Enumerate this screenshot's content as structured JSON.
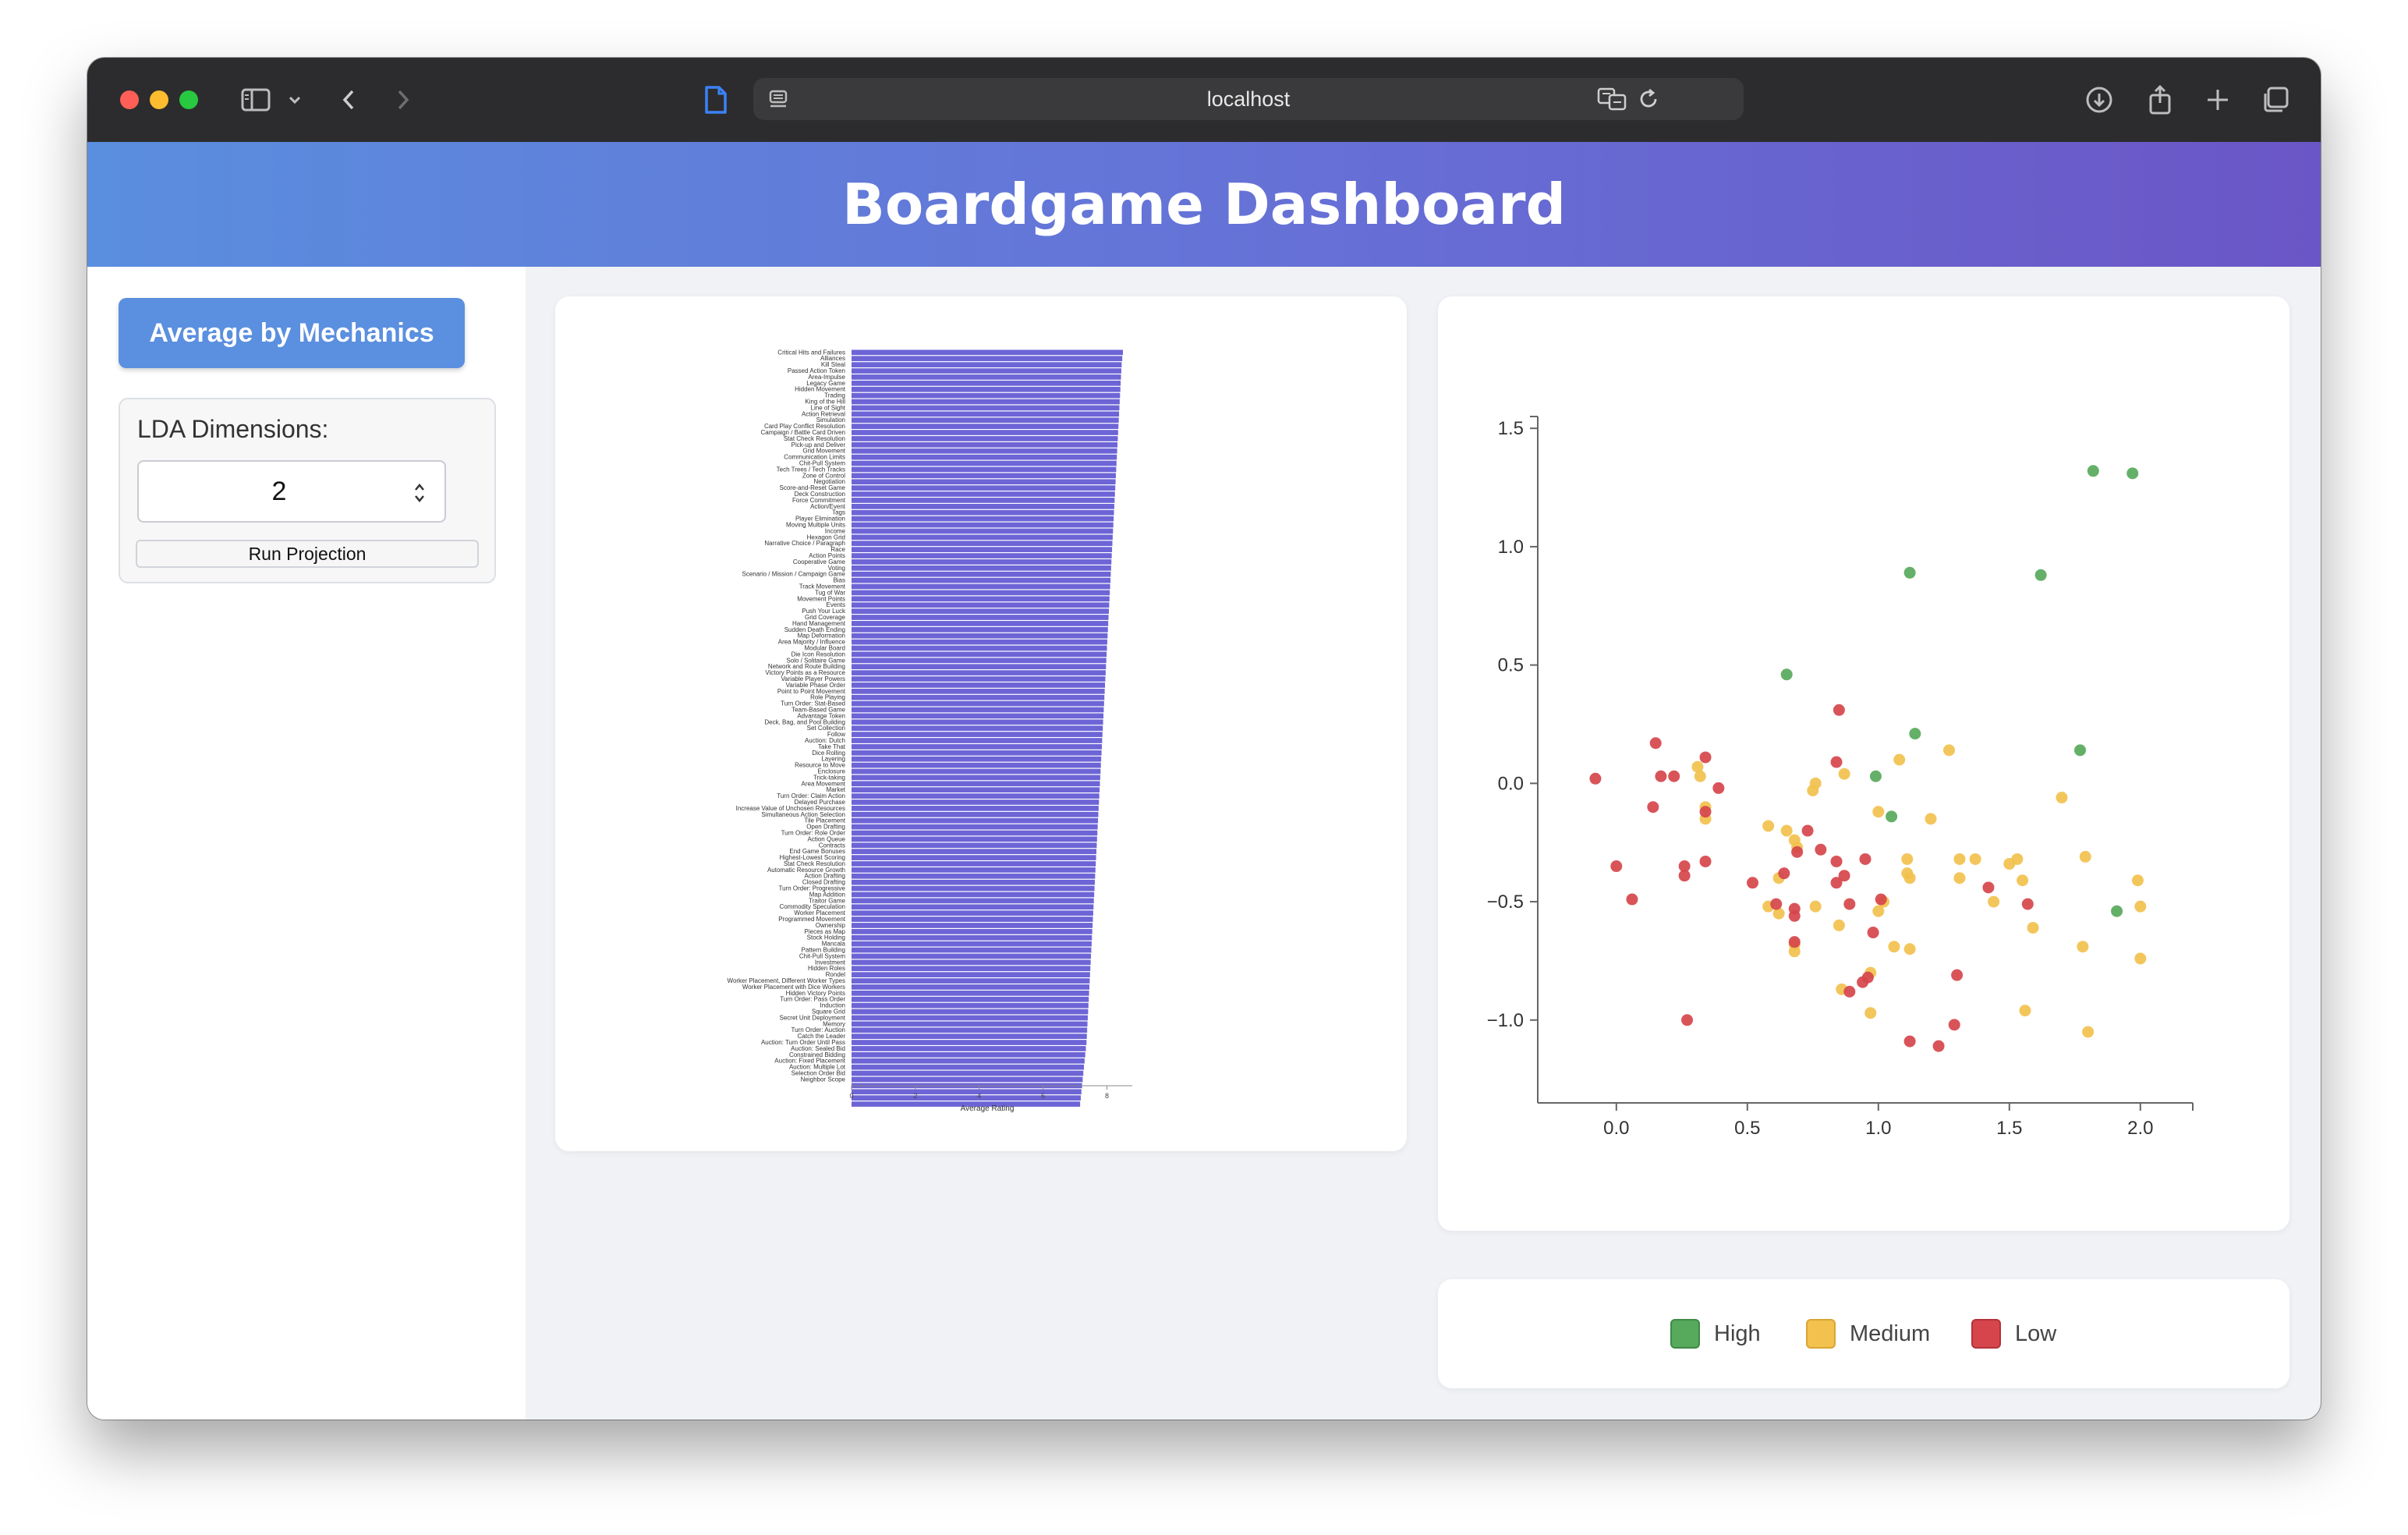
{
  "browser": {
    "url": "localhost"
  },
  "header": {
    "title": "Boardgame Dashboard"
  },
  "sidebar": {
    "average_button_label": "Average by Mechanics",
    "lda_label": "LDA Dimensions:",
    "lda_value": "2",
    "run_button_label": "Run Projection"
  },
  "colors": {
    "high": "#57a95b",
    "medium": "#f2c14e",
    "low": "#d6454b",
    "bar": "#6d64d6",
    "header_start": "#5a8ede",
    "header_end": "#6b56c6"
  },
  "legend": {
    "high": "High",
    "medium": "Medium",
    "low": "Low"
  },
  "chart_data": [
    {
      "type": "bar",
      "orientation": "horizontal",
      "xlabel": "Average Rating",
      "xlim": [
        0,
        8.5
      ],
      "xticks": [
        0,
        2,
        4,
        6,
        8
      ],
      "categories": [
        "Critical Hits and Failures",
        "Alliances",
        "Kill Steal",
        "Passed Action Token",
        "Area-Impulse",
        "Legacy Game",
        "Hidden Movement",
        "Trading",
        "King of the Hill",
        "Line of Sight",
        "Action Retrieval",
        "Simulation",
        "Card Play Conflict Resolution",
        "Campaign / Battle Card Driven",
        "Stat Check Resolution",
        "Pick-up and Deliver",
        "Grid Movement",
        "Communication Limits",
        "Chit-Pull System",
        "Tech Trees / Tech Tracks",
        "Zone of Control",
        "Negotiation",
        "Score-and-Reset Game",
        "Deck Construction",
        "Force Commitment",
        "Action/Event",
        "Tags",
        "Player Elimination",
        "Moving Multiple Units",
        "Income",
        "Hexagon Grid",
        "Narrative Choice / Paragraph",
        "Race",
        "Action Points",
        "Cooperative Game",
        "Voting",
        "Scenario / Mission / Campaign Game",
        "Bias",
        "Track Movement",
        "Tug of War",
        "Movement Points",
        "Events",
        "Push Your Luck",
        "Grid Coverage",
        "Hand Management",
        "Sudden Death Ending",
        "Map Deformation",
        "Area Majority / Influence",
        "Modular Board",
        "Die Icon Resolution",
        "Solo / Solitaire Game",
        "Network and Route Building",
        "Victory Points as a Resource",
        "Variable Player Powers",
        "Variable Phase Order",
        "Point to Point Movement",
        "Role Playing",
        "Turn Order: Stat-Based",
        "Team-Based Game",
        "Advantage Token",
        "Deck, Bag, and Pool Building",
        "Set Collection",
        "Follow",
        "Auction: Dutch",
        "Take That",
        "Dice Rolling",
        "Layering",
        "Resource to Move",
        "Enclosure",
        "Trick-taking",
        "Area Movement",
        "Market",
        "Turn Order: Claim Action",
        "Delayed Purchase",
        "Increase Value of Unchosen Resources",
        "Simultaneous Action Selection",
        "Tile Placement",
        "Open Drafting",
        "Turn Order: Role Order",
        "Action Queue",
        "Contracts",
        "End Game Bonuses",
        "Highest-Lowest Scoring",
        "Stat Check Resolution",
        "Automatic Resource Growth",
        "Action Drafting",
        "Closed Drafting",
        "Turn Order: Progressive",
        "Map Addition",
        "Traitor Game",
        "Commodity Speculation",
        "Worker Placement",
        "Programmed Movement",
        "Ownership",
        "Pieces as Map",
        "Stock Holding",
        "Mancala",
        "Pattern Building",
        "Chit-Pull System",
        "Investment",
        "Hidden Roles",
        "Rondel",
        "Worker Placement, Different Worker Types",
        "Worker Placement with Dice Workers",
        "Hidden Victory Points",
        "Turn Order: Pass Order",
        "Induction",
        "Square Grid",
        "Secret Unit Deployment",
        "Memory",
        "Turn Order: Auction",
        "Catch the Leader",
        "Auction: Turn Order Until Pass",
        "Auction: Sealed Bid",
        "Constrained Bidding",
        "Auction: Fixed Placement",
        "Auction: Multiple Lot",
        "Selection Order Bid",
        "Neighbor Scope"
      ],
      "values": [
        8.5,
        8.48,
        8.46,
        8.45,
        8.44,
        8.43,
        8.42,
        8.41,
        8.4,
        8.39,
        8.38,
        8.37,
        8.36,
        8.35,
        8.34,
        8.33,
        8.32,
        8.31,
        8.3,
        8.29,
        8.28,
        8.27,
        8.26,
        8.25,
        8.24,
        8.23,
        8.22,
        8.21,
        8.2,
        8.19,
        8.18,
        8.17,
        8.16,
        8.15,
        8.14,
        8.13,
        8.12,
        8.11,
        8.1,
        8.09,
        8.08,
        8.07,
        8.06,
        8.05,
        8.04,
        8.03,
        8.02,
        8.01,
        8.0,
        7.99,
        7.98,
        7.97,
        7.96,
        7.95,
        7.94,
        7.93,
        7.92,
        7.91,
        7.9,
        7.89,
        7.88,
        7.87,
        7.86,
        7.85,
        7.84,
        7.83,
        7.82,
        7.81,
        7.8,
        7.79,
        7.78,
        7.77,
        7.76,
        7.75,
        7.74,
        7.73,
        7.72,
        7.71,
        7.7,
        7.69,
        7.68,
        7.67,
        7.66,
        7.65,
        7.64,
        7.63,
        7.62,
        7.61,
        7.6,
        7.59,
        7.58,
        7.57,
        7.56,
        7.55,
        7.54,
        7.53,
        7.52,
        7.51,
        7.5,
        7.49,
        7.48,
        7.47,
        7.46,
        7.45,
        7.44,
        7.43,
        7.42,
        7.41,
        7.4,
        7.39,
        7.38,
        7.37,
        7.36,
        7.34,
        7.32,
        7.3,
        7.28,
        7.26,
        7.24,
        7.22,
        7.2,
        7.18,
        7.16
      ]
    },
    {
      "type": "scatter",
      "xlim": [
        -0.3,
        2.2
      ],
      "ylim": [
        -1.35,
        1.55
      ],
      "xticks": [
        0.0,
        0.5,
        1.0,
        1.5,
        2.0
      ],
      "yticks": [
        1.5,
        1.0,
        0.5,
        0.0,
        -0.5,
        -1.0
      ],
      "series": [
        {
          "name": "High",
          "points": [
            [
              1.82,
              1.32
            ],
            [
              1.97,
              1.31
            ],
            [
              1.12,
              0.89
            ],
            [
              1.62,
              0.88
            ],
            [
              0.65,
              0.46
            ],
            [
              1.14,
              0.21
            ],
            [
              1.77,
              0.14
            ],
            [
              0.99,
              0.03
            ],
            [
              1.05,
              -0.14
            ],
            [
              1.91,
              -0.54
            ]
          ]
        },
        {
          "name": "Medium",
          "points": [
            [
              0.31,
              0.07
            ],
            [
              0.32,
              0.03
            ],
            [
              0.34,
              -0.1
            ],
            [
              0.34,
              -0.15
            ],
            [
              0.58,
              -0.18
            ],
            [
              0.65,
              -0.2
            ],
            [
              0.68,
              -0.24
            ],
            [
              0.69,
              -0.27
            ],
            [
              0.62,
              -0.4
            ],
            [
              0.76,
              0.0
            ],
            [
              0.75,
              -0.03
            ],
            [
              0.87,
              0.04
            ],
            [
              1.08,
              0.1
            ],
            [
              1.27,
              0.14
            ],
            [
              1.0,
              -0.12
            ],
            [
              1.2,
              -0.15
            ],
            [
              1.11,
              -0.32
            ],
            [
              1.31,
              -0.32
            ],
            [
              1.37,
              -0.32
            ],
            [
              1.5,
              -0.34
            ],
            [
              1.53,
              -0.32
            ],
            [
              1.11,
              -0.38
            ],
            [
              1.12,
              -0.4
            ],
            [
              1.31,
              -0.4
            ],
            [
              1.55,
              -0.41
            ],
            [
              1.7,
              -0.06
            ],
            [
              1.79,
              -0.31
            ],
            [
              1.99,
              -0.41
            ],
            [
              0.58,
              -0.52
            ],
            [
              0.62,
              -0.55
            ],
            [
              0.68,
              -0.68
            ],
            [
              0.68,
              -0.71
            ],
            [
              0.76,
              -0.52
            ],
            [
              0.85,
              -0.6
            ],
            [
              1.02,
              -0.5
            ],
            [
              1.0,
              -0.54
            ],
            [
              1.06,
              -0.69
            ],
            [
              1.12,
              -0.7
            ],
            [
              1.44,
              -0.5
            ],
            [
              1.59,
              -0.61
            ],
            [
              1.78,
              -0.69
            ],
            [
              2.0,
              -0.52
            ],
            [
              2.0,
              -0.74
            ],
            [
              0.86,
              -0.87
            ],
            [
              0.97,
              -0.8
            ],
            [
              0.97,
              -0.97
            ],
            [
              1.56,
              -0.96
            ],
            [
              1.8,
              -1.05
            ]
          ]
        },
        {
          "name": "Low",
          "points": [
            [
              -0.08,
              0.02
            ],
            [
              0.15,
              0.17
            ],
            [
              0.17,
              0.03
            ],
            [
              0.22,
              0.03
            ],
            [
              0.14,
              -0.1
            ],
            [
              0.34,
              0.11
            ],
            [
              0.39,
              -0.02
            ],
            [
              0.34,
              -0.12
            ],
            [
              0.0,
              -0.35
            ],
            [
              0.26,
              -0.35
            ],
            [
              0.26,
              -0.39
            ],
            [
              0.34,
              -0.33
            ],
            [
              0.06,
              -0.49
            ],
            [
              0.52,
              -0.42
            ],
            [
              0.85,
              0.31
            ],
            [
              0.84,
              0.09
            ],
            [
              0.73,
              -0.2
            ],
            [
              0.69,
              -0.29
            ],
            [
              0.78,
              -0.28
            ],
            [
              0.84,
              -0.33
            ],
            [
              0.95,
              -0.32
            ],
            [
              0.87,
              -0.39
            ],
            [
              0.84,
              -0.42
            ],
            [
              0.64,
              -0.38
            ],
            [
              0.61,
              -0.51
            ],
            [
              0.68,
              -0.53
            ],
            [
              0.68,
              -0.56
            ],
            [
              0.89,
              -0.51
            ],
            [
              1.01,
              -0.49
            ],
            [
              0.98,
              -0.63
            ],
            [
              1.42,
              -0.44
            ],
            [
              1.57,
              -0.51
            ],
            [
              0.68,
              -0.67
            ],
            [
              0.94,
              -0.84
            ],
            [
              0.96,
              -0.82
            ],
            [
              0.89,
              -0.88
            ],
            [
              1.3,
              -0.81
            ],
            [
              0.27,
              -1.0
            ],
            [
              1.29,
              -1.02
            ],
            [
              1.12,
              -1.09
            ],
            [
              1.23,
              -1.11
            ]
          ]
        }
      ]
    }
  ]
}
